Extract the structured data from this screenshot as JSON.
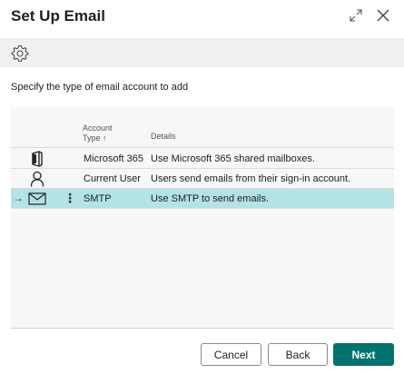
{
  "dialog": {
    "title": "Set Up Email"
  },
  "instruction": "Specify the type of email account to add",
  "grid": {
    "columns": {
      "account_type_line1": "Account",
      "account_type_line2": "Type",
      "sort_indicator": "↑",
      "details": "Details"
    },
    "rows": [
      {
        "account_type": "Microsoft 365",
        "details": "Use Microsoft 365 shared mailboxes.",
        "icon": "office-icon",
        "selected": false
      },
      {
        "account_type": "Current User",
        "details": "Users send emails from their sign-in account.",
        "icon": "user-icon",
        "selected": false
      },
      {
        "account_type": "SMTP",
        "details": "Use SMTP to send emails.",
        "icon": "envelope-icon",
        "selected": true
      }
    ]
  },
  "buttons": {
    "cancel": "Cancel",
    "back": "Back",
    "next": "Next"
  },
  "colors": {
    "primary": "#00736f",
    "selected_row": "#b3e3e5",
    "action_bar": "#f0f0f0"
  }
}
